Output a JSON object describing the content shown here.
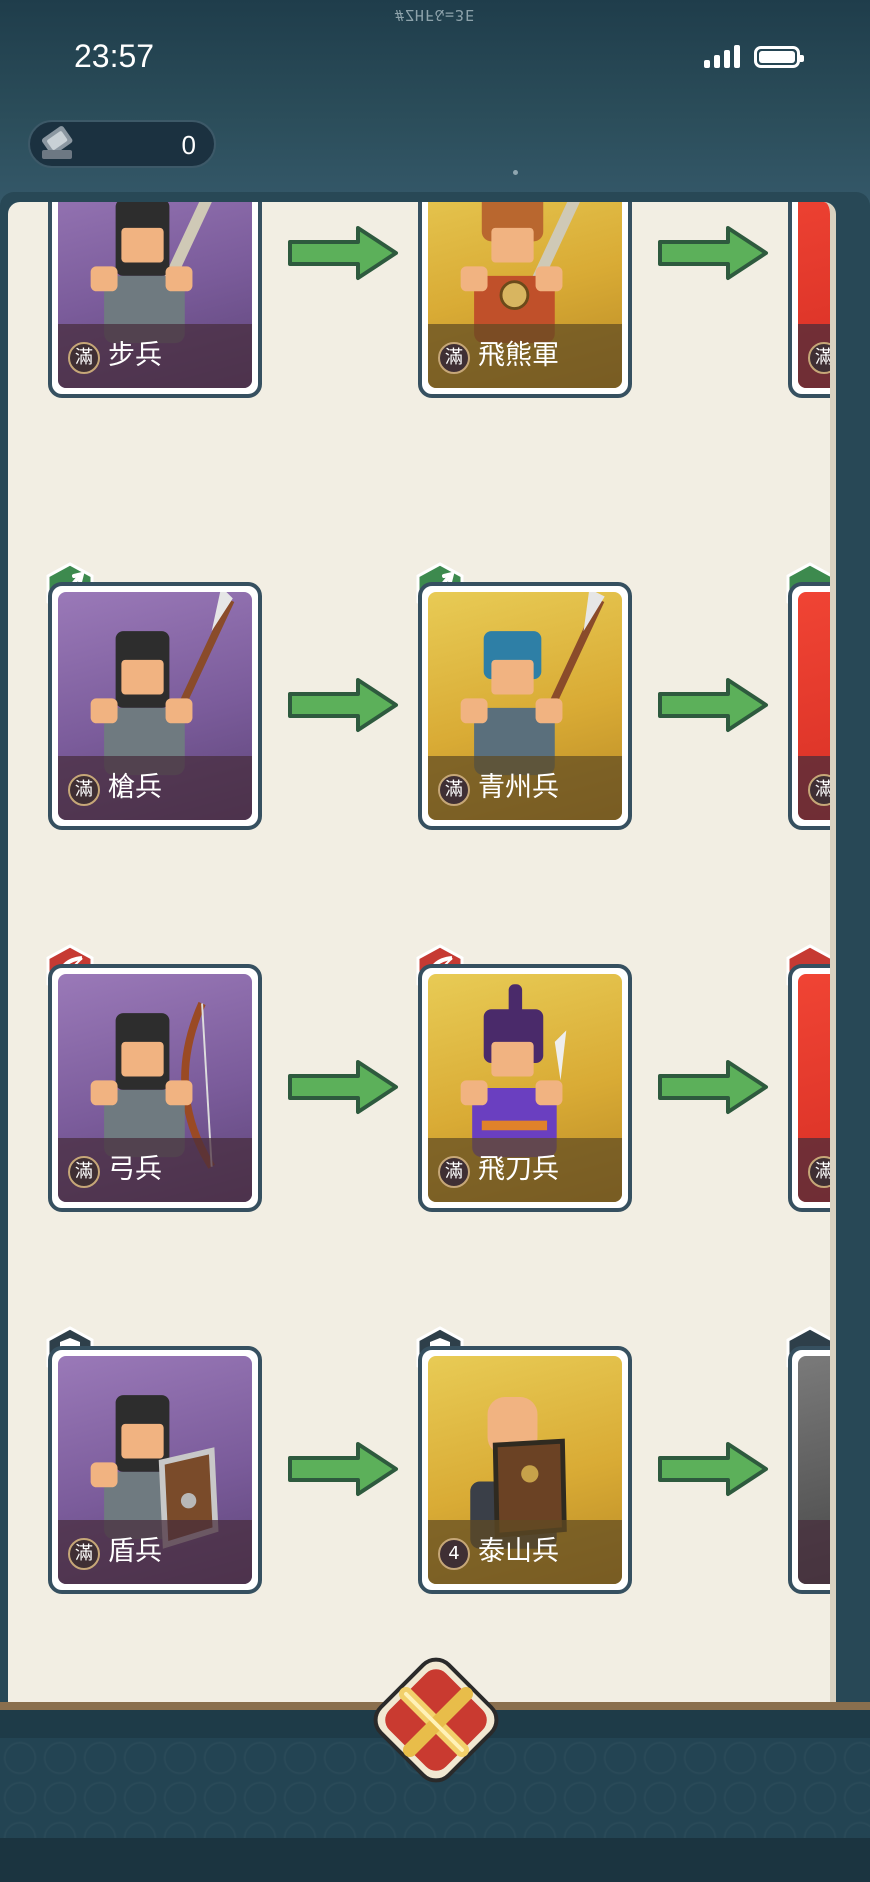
{
  "status_bar": {
    "time": "23:57",
    "mirrored_text": "#ZHF&=3E"
  },
  "resource": {
    "icon": "anvil-icon",
    "value": "0"
  },
  "rows": [
    {
      "class_icon": "none",
      "cards": [
        {
          "tier": "purple",
          "badge": "滿",
          "name": "步兵"
        },
        {
          "tier": "gold",
          "badge": "滿",
          "name": "飛熊軍"
        },
        {
          "tier": "red",
          "badge": "滿",
          "name": ""
        }
      ]
    },
    {
      "class_icon": "spear-icon",
      "cards": [
        {
          "tier": "purple",
          "badge": "滿",
          "name": "槍兵"
        },
        {
          "tier": "gold",
          "badge": "滿",
          "name": "青州兵"
        },
        {
          "tier": "red",
          "badge": "滿",
          "name": ""
        }
      ]
    },
    {
      "class_icon": "bow-icon",
      "cards": [
        {
          "tier": "purple",
          "badge": "滿",
          "name": "弓兵"
        },
        {
          "tier": "gold",
          "badge": "滿",
          "name": "飛刀兵"
        },
        {
          "tier": "red",
          "badge": "滿",
          "name": ""
        }
      ]
    },
    {
      "class_icon": "shield-icon",
      "cards": [
        {
          "tier": "purple",
          "badge": "滿",
          "name": "盾兵"
        },
        {
          "tier": "gold",
          "badge": "4",
          "name": "泰山兵"
        },
        {
          "tier": "grey",
          "badge": "",
          "name": ""
        }
      ]
    }
  ],
  "colors": {
    "arrow": "#5cb05a",
    "card_border": "#365060",
    "panel": "#f2eee3",
    "frame": "#1e3b48"
  },
  "bottom": {
    "craft_button_icon": "crossed-swords-icon"
  }
}
